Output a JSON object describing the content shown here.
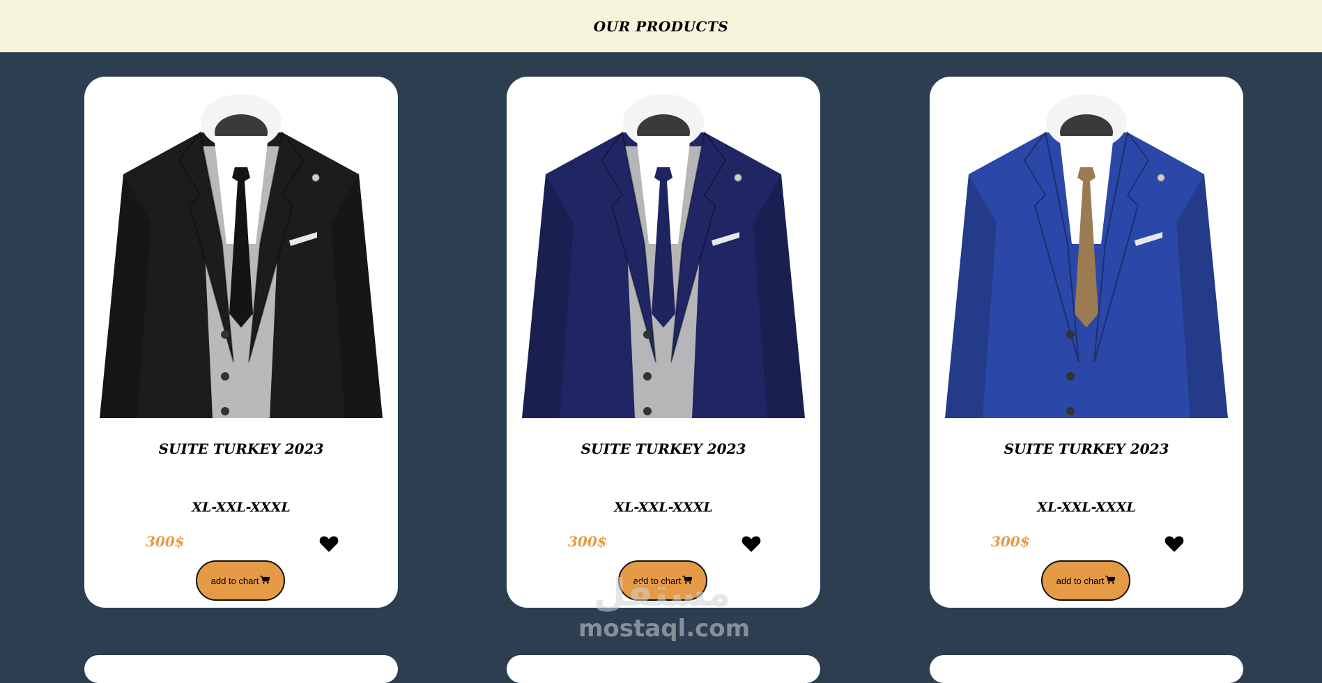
{
  "header": {
    "title": "OUR PRODUCTS"
  },
  "products": [
    {
      "name": "SUITE TURKEY 2023",
      "sizes": "XL-XXL-XXXL",
      "price": "300$",
      "button_label": "add to chart",
      "jacket_color": "#1c1c1e",
      "tie_color": "#141414",
      "vest_color": "#b9b9bb"
    },
    {
      "name": "SUITE TURKEY 2023",
      "sizes": "XL-XXL-XXXL",
      "price": "300$",
      "button_label": "add to chart",
      "jacket_color": "#1f2663",
      "tie_color": "#1e2460",
      "vest_color": "#b6b6b8"
    },
    {
      "name": "SUITE TURKEY 2023",
      "sizes": "XL-XXL-XXXL",
      "price": "300$",
      "button_label": "add to chart",
      "jacket_color": "#2b48a8",
      "tie_color": "#9c7b52",
      "vest_color": "#2b48a8"
    }
  ],
  "watermark": {
    "arabic": "مستقل",
    "latin": "mostaql.com"
  },
  "colors": {
    "page_bg": "#2c3e50",
    "header_bg": "#f5f5dc",
    "accent": "#e59b45"
  }
}
